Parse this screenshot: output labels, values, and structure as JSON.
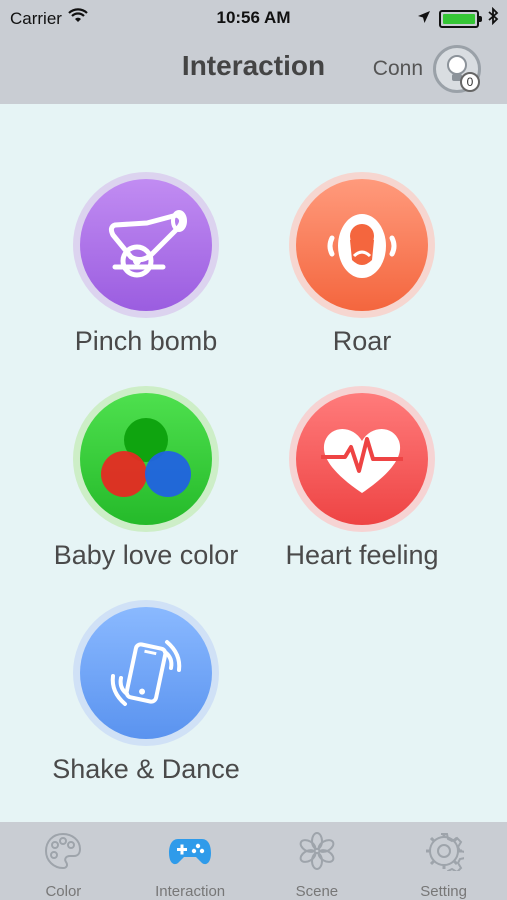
{
  "status_bar": {
    "carrier": "Carrier",
    "time": "10:56 AM",
    "battery_level": 1.0
  },
  "nav": {
    "title": "Interaction",
    "conn_label": "Conn",
    "badge": "0"
  },
  "items": [
    {
      "label": "Pinch bomb",
      "icon": "cannon-icon",
      "color": "#b07aec"
    },
    {
      "label": "Roar",
      "icon": "roar-face-icon",
      "color": "#f97f5c"
    },
    {
      "label": "Baby love color",
      "icon": "rgb-circles-icon",
      "color": "#3cd03c"
    },
    {
      "label": "Heart feeling",
      "icon": "heartbeat-icon",
      "color": "#f55c5c"
    },
    {
      "label": "Shake & Dance",
      "icon": "phone-shake-icon",
      "color": "#74a8f8"
    }
  ],
  "tabs": [
    {
      "label": "Color",
      "icon": "palette-icon",
      "active": false
    },
    {
      "label": "Interaction",
      "icon": "gamepad-icon",
      "active": true
    },
    {
      "label": "Scene",
      "icon": "flower-icon",
      "active": false
    },
    {
      "label": "Setting",
      "icon": "gear-icon",
      "active": false
    }
  ],
  "colors": {
    "bar_bg": "#c9cdd3",
    "page_bg": "#e6f4f5",
    "active_tab": "#2f9bea",
    "inactive_tab": "#9ea4ab"
  }
}
